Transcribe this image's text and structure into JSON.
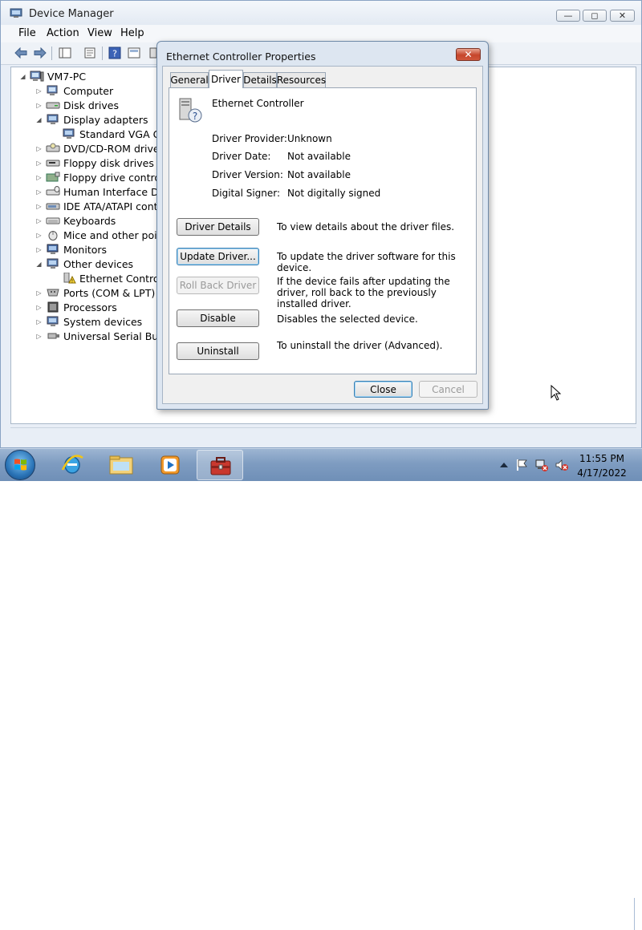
{
  "window": {
    "title": "Device Manager",
    "controls": {
      "minimize": "—",
      "maximize": "◻",
      "close": "✕"
    }
  },
  "menu": [
    "File",
    "Action",
    "View",
    "Help"
  ],
  "toolbar_icons": [
    "back-arrow-icon",
    "forward-arrow-icon",
    "show-hide-tree-icon",
    "properties-icon",
    "help-icon",
    "view-icon",
    "scan-hardware-icon"
  ],
  "tree": {
    "root": "VM7-PC",
    "items": [
      {
        "label": "Computer",
        "expanded": false,
        "icon": "computer-icon"
      },
      {
        "label": "Disk drives",
        "expanded": false,
        "icon": "disk-drive-icon"
      },
      {
        "label": "Display adapters",
        "expanded": true,
        "icon": "display-adapter-icon"
      },
      {
        "label": "Standard VGA Grap",
        "child": true,
        "icon": "display-adapter-icon"
      },
      {
        "label": "DVD/CD-ROM drives",
        "expanded": false,
        "icon": "dvd-drive-icon"
      },
      {
        "label": "Floppy disk drives",
        "expanded": false,
        "icon": "floppy-icon"
      },
      {
        "label": "Floppy drive controller",
        "expanded": false,
        "icon": "controller-icon"
      },
      {
        "label": "Human Interface Devic",
        "expanded": false,
        "icon": "hid-icon"
      },
      {
        "label": "IDE ATA/ATAPI contro",
        "expanded": false,
        "icon": "ide-icon"
      },
      {
        "label": "Keyboards",
        "expanded": false,
        "icon": "keyboard-icon"
      },
      {
        "label": "Mice and other pointin",
        "expanded": false,
        "icon": "mouse-icon"
      },
      {
        "label": "Monitors",
        "expanded": false,
        "icon": "monitor-icon"
      },
      {
        "label": "Other devices",
        "expanded": true,
        "icon": "other-devices-icon"
      },
      {
        "label": "Ethernet Controller",
        "child": true,
        "icon": "unknown-device-warning-icon"
      },
      {
        "label": "Ports (COM & LPT)",
        "expanded": false,
        "icon": "port-icon"
      },
      {
        "label": "Processors",
        "expanded": false,
        "icon": "processor-icon"
      },
      {
        "label": "System devices",
        "expanded": false,
        "icon": "system-device-icon"
      },
      {
        "label": "Universal Serial Bus co",
        "expanded": false,
        "icon": "usb-icon"
      }
    ]
  },
  "dialog": {
    "title": "Ethernet Controller Properties",
    "close": "✕",
    "tabs": [
      "General",
      "Driver",
      "Details",
      "Resources"
    ],
    "active_tab": "Driver",
    "device_name": "Ethernet Controller",
    "info": {
      "provider_label": "Driver Provider:",
      "provider_value": "Unknown",
      "date_label": "Driver Date:",
      "date_value": "Not available",
      "version_label": "Driver Version:",
      "version_value": "Not available",
      "signer_label": "Digital Signer:",
      "signer_value": "Not digitally signed"
    },
    "actions": {
      "details_label": "Driver Details",
      "details_desc": "To view details about the driver files.",
      "update_label": "Update Driver...",
      "update_desc": "To update the driver software for this device.",
      "rollback_label": "Roll Back Driver",
      "rollback_desc": "If the device fails after updating the driver, roll back to the previously installed driver.",
      "disable_label": "Disable",
      "disable_desc": "Disables the selected device.",
      "uninstall_label": "Uninstall",
      "uninstall_desc": "To uninstall the driver (Advanced)."
    },
    "buttons": {
      "close": "Close",
      "cancel": "Cancel"
    }
  },
  "taskbar": {
    "apps": [
      "internet-explorer-icon",
      "file-explorer-icon",
      "media-player-icon",
      "device-manager-icon"
    ],
    "active_app": "device-manager-icon",
    "tray_icons": [
      "show-hidden-icons-icon",
      "action-center-flag-icon",
      "network-disconnected-icon",
      "volume-muted-icon"
    ],
    "time": "11:55 PM",
    "date": "4/17/2022"
  }
}
